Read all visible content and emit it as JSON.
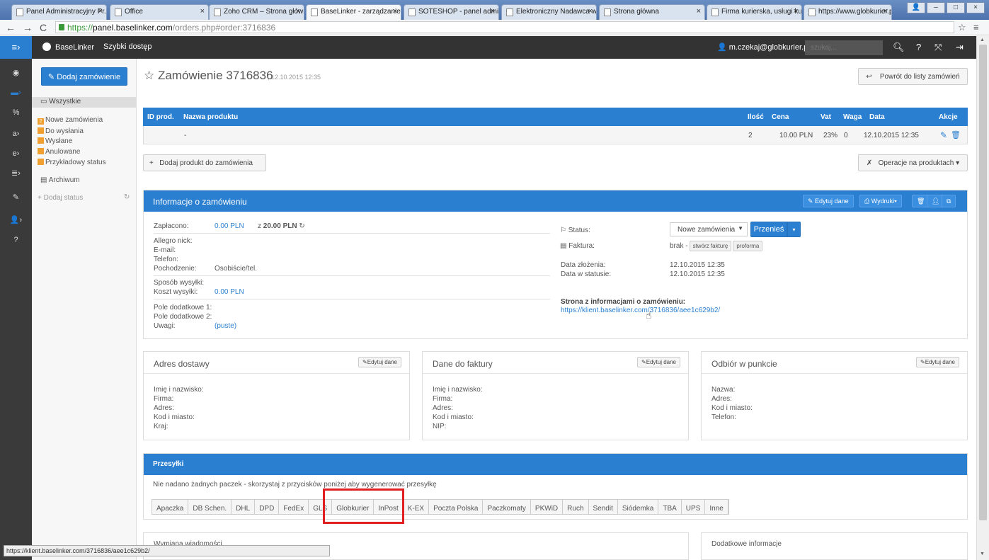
{
  "browser": {
    "tabs": [
      "Panel Administracyjny Pr...",
      "Office",
      "Zoho CRM – Strona główn",
      "BaseLinker - zarządzanie z",
      "SOTESHOP - panel admin",
      "Elektroniczny Nadawca w",
      "Strona główna",
      "Firma kurierska, usługi kur",
      "https://www.globkurier.pl"
    ],
    "url_scheme": "https://",
    "url_host": "panel.baselinker.com",
    "url_path": "/orders.php#order:3716836",
    "status_url": "https://klient.baselinker.com/3716836/aee1c629b2/"
  },
  "topbar": {
    "brand": "BaseLinker",
    "quick": "Szybki dostęp",
    "user": "m.czekaj@globkurier.pl",
    "search_placeholder": "szukaj..."
  },
  "sidebar": {
    "add_order": "Dodaj zamówienie",
    "all": "Wszystkie",
    "statuses": [
      {
        "badge": "2",
        "label": "Nowe zamówienia"
      },
      {
        "badge": "",
        "label": "Do wysłania"
      },
      {
        "badge": "",
        "label": "Wysłane"
      },
      {
        "badge": "",
        "label": "Anulowane"
      },
      {
        "badge": "",
        "label": "Przykładowy status"
      }
    ],
    "archive": "Archiwum",
    "add_status": "+ Dodaj status"
  },
  "order": {
    "title": "Zamówienie 3716836",
    "date": ", 12.10.2015 12:35",
    "back": "Powrót do listy zamówień"
  },
  "products": {
    "headers": [
      "ID prod.",
      "Nazwa produktu",
      "Ilość",
      "Cena",
      "Vat",
      "Waga",
      "Data",
      "Akcje"
    ],
    "row": {
      "id": "",
      "name": "-",
      "qty": "2",
      "price": "10.00 PLN",
      "vat": "23%",
      "weight": "0",
      "date": "12.10.2015 12:35"
    },
    "add": "Dodaj produkt do zamówienia",
    "ops": "Operacje na produktach"
  },
  "info": {
    "title": "Informacje o zamówieniu",
    "edit": "Edytuj dane",
    "prints": "Wydruki",
    "paid_label": "Zapłacono:",
    "paid_value": "0.00 PLN",
    "paid_of": "z",
    "paid_total": "20.00 PLN",
    "allegro": "Allegro nick:",
    "email": "E-mail:",
    "phone": "Telefon:",
    "origin_label": "Pochodzenie:",
    "origin_value": "Osobiście/tel.",
    "ship_method": "Sposób wysyłki:",
    "ship_cost_label": "Koszt wysyłki:",
    "ship_cost_value": "0.00 PLN",
    "extra1": "Pole dodatkowe 1:",
    "extra2": "Pole dodatkowe 2:",
    "notes_label": "Uwagi:",
    "notes_value": "(puste)",
    "status_label": "Status:",
    "status_value": "Nowe zamówienia",
    "move": "Przenieś",
    "invoice_label": "Faktura:",
    "invoice_value": "brak -",
    "make_invoice": "stwórz fakturę",
    "proforma": "proforma",
    "created_label": "Data złożenia:",
    "created_value": "12.10.2015 12:35",
    "status_date_label": "Data w statusie:",
    "status_date_value": "12.10.2015 12:35",
    "page_label": "Strona z informacjami o zamówieniu:",
    "page_link": "https://klient.baselinker.com/3716836/aee1c629b2/"
  },
  "delivery": {
    "title": "Adres dostawy",
    "edit": "Edytuj dane",
    "lines": [
      "Imię i nazwisko:",
      "Firma:",
      "Adres:",
      "Kod i miasto:",
      "Kraj:"
    ]
  },
  "invoice": {
    "title": "Dane do faktury",
    "edit": "Edytuj dane",
    "lines": [
      "Imię i nazwisko:",
      "Firma:",
      "Adres:",
      "Kod i miasto:",
      "NIP:"
    ]
  },
  "pickup": {
    "title": "Odbiór w punkcie",
    "edit": "Edytuj dane",
    "lines": [
      "Nazwa:",
      "Adres:",
      "Kod i miasto:",
      "Telefon:"
    ]
  },
  "shipments": {
    "title": "Przesyłki",
    "message": "Nie nadano żadnych paczek - skorzystaj z przycisków poniżej aby wygenerować przesyłkę",
    "couriers": [
      "Apaczka",
      "DB Schen.",
      "DHL",
      "DPD",
      "FedEx",
      "GLS",
      "Globkurier",
      "InPost",
      "K-EX",
      "Poczta Polska",
      "Paczkomaty",
      "PKWiD",
      "Ruch",
      "Sendit",
      "Siódemka",
      "TBA",
      "UPS",
      "Inne"
    ]
  },
  "messages": {
    "title": "Wymiana wiadomości"
  },
  "extra_info": {
    "title": "Dodatkowe informacje"
  }
}
